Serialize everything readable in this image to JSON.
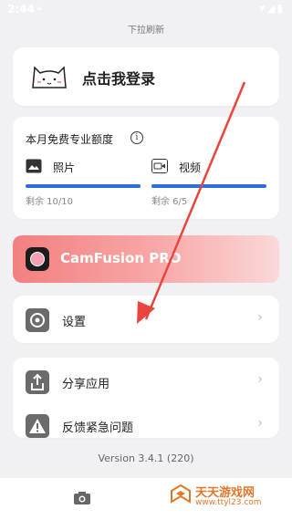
{
  "status_bar": {
    "time": "2:44"
  },
  "pulldown_hint": "下拉刷新",
  "login": {
    "label": "点击我登录"
  },
  "quota": {
    "title": "本月免费专业额度",
    "items": [
      {
        "label": "照片",
        "remaining": "剩余 10/10"
      },
      {
        "label": "视频",
        "remaining": "剩余 6/5"
      }
    ]
  },
  "pro": {
    "label": "CamFusion PRO"
  },
  "menu": {
    "settings": "设置",
    "share": "分享应用",
    "feedback": "反馈紧急问题"
  },
  "version": "Version 3.4.1 (220)",
  "watermark": {
    "title": "天天游戏网",
    "url": "www.ttyl23.com"
  },
  "colors": {
    "accent": "#2f6fdd",
    "pro_gradient_start": "#f37f7f",
    "background": "#f1f1f4"
  }
}
